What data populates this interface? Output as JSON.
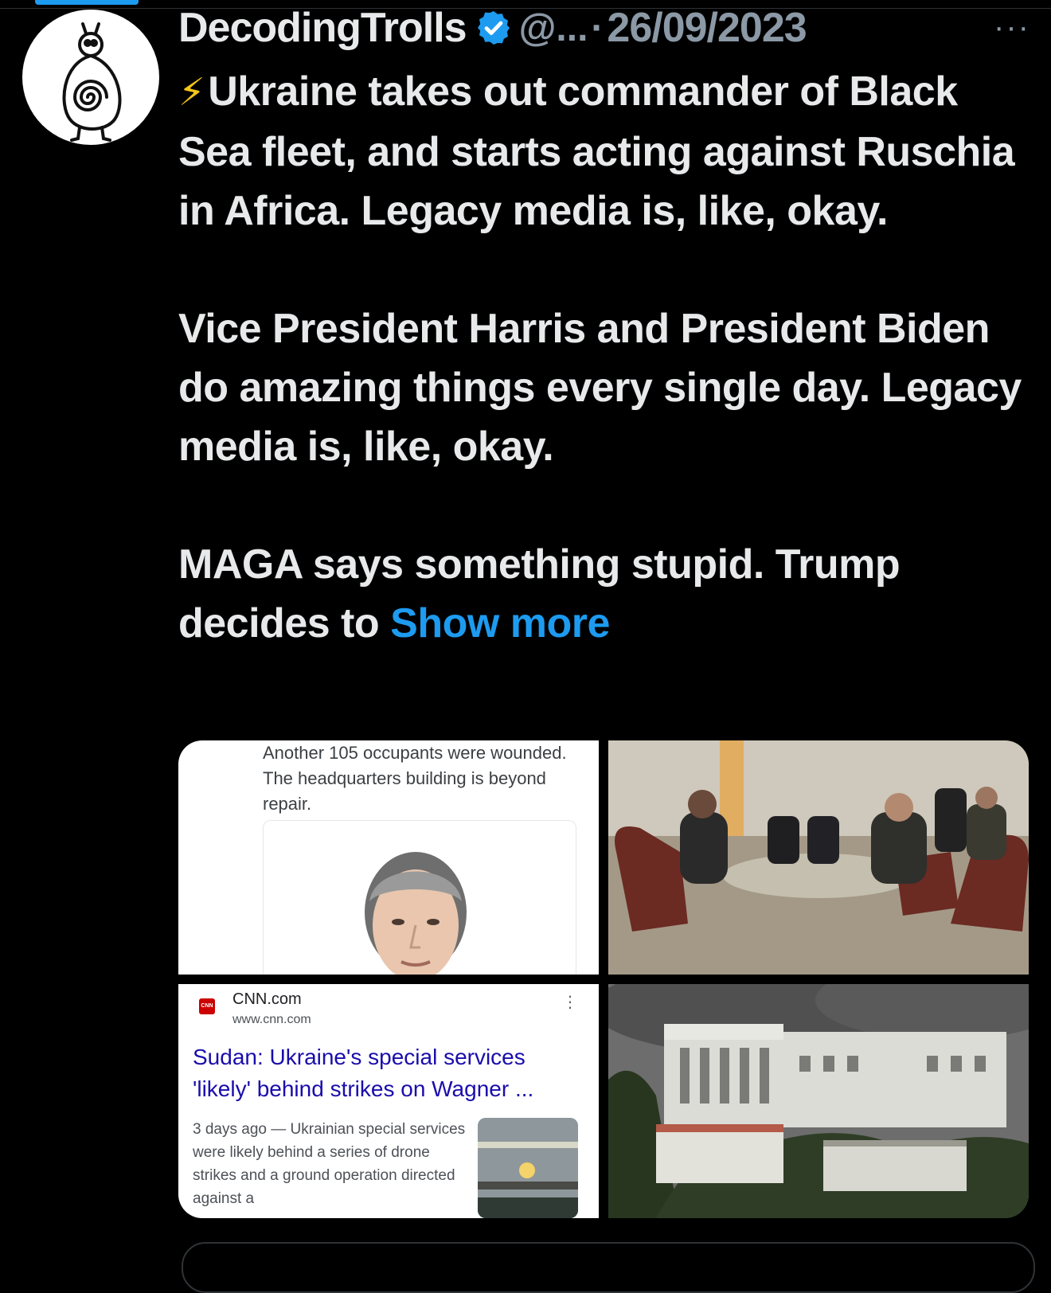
{
  "tweet": {
    "display_name": "DecodingTrolls",
    "handle": "@...",
    "separator": "·",
    "date": "26/09/2023",
    "more_icon": "···",
    "verified_color": "#1d9bf0",
    "paragraphs": [
      "Ukraine takes out commander of Black Sea fleet, and starts acting against Ruschia in  Africa. Legacy media is, like, okay.",
      "Vice President Harris and President Biden do amazing things every single day. Legacy media is, like, okay.",
      "MAGA says something stupid. Trump decides to"
    ],
    "lead_emoji": "⚡",
    "show_more_label": "Show more"
  },
  "media": {
    "image1": {
      "text": "Another 105 occupants were wounded. The headquarters building is beyond repair."
    },
    "image3": {
      "logo_text": "CNN",
      "source": "CNN.com",
      "url": "www.cnn.com",
      "kebab": "⋮",
      "headline": "Sudan: Ukraine's special services 'likely' behind strikes on Wagner ...",
      "snippet": "3 days ago — Ukrainian special services were likely behind a series of drone strikes and a ground operation directed against a"
    }
  }
}
